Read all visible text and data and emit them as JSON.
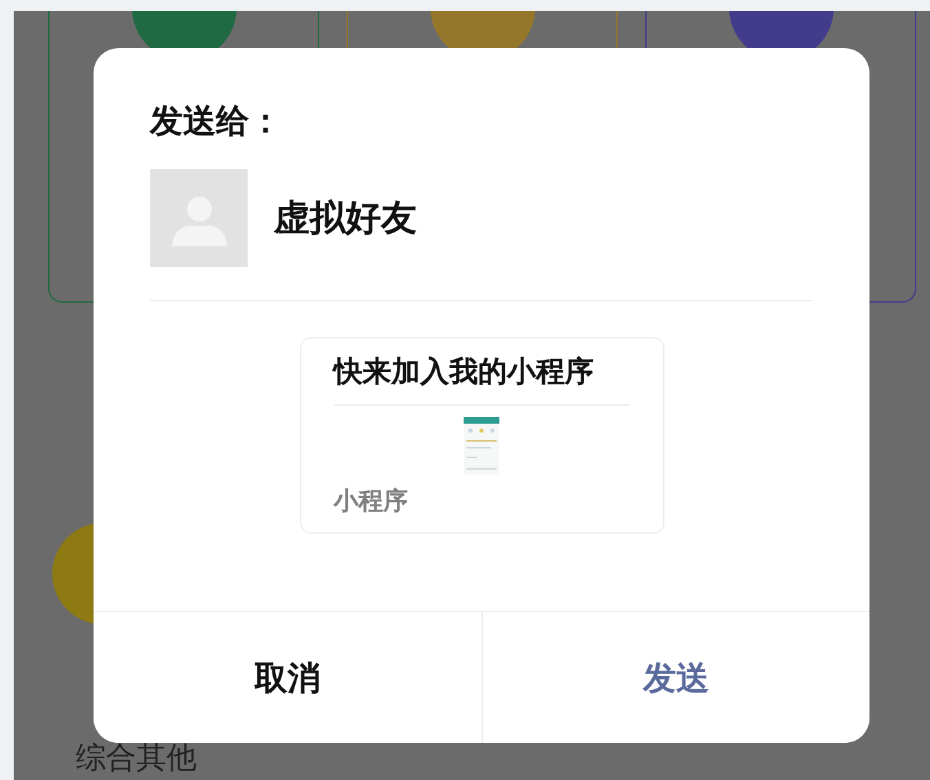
{
  "background": {
    "cards": [
      {
        "color": "#1f6a42"
      },
      {
        "color": "#94772a"
      },
      {
        "color": "#433c8c"
      }
    ],
    "section_label": "综合其他"
  },
  "dialog": {
    "title": "发送给：",
    "recipient": {
      "name": "虚拟好友"
    },
    "share_card": {
      "title": "快来加入我的小程序",
      "source": "小程序"
    },
    "buttons": [
      {
        "label": "取消",
        "kind": "cancel"
      },
      {
        "label": "发送",
        "kind": "primary"
      }
    ]
  }
}
